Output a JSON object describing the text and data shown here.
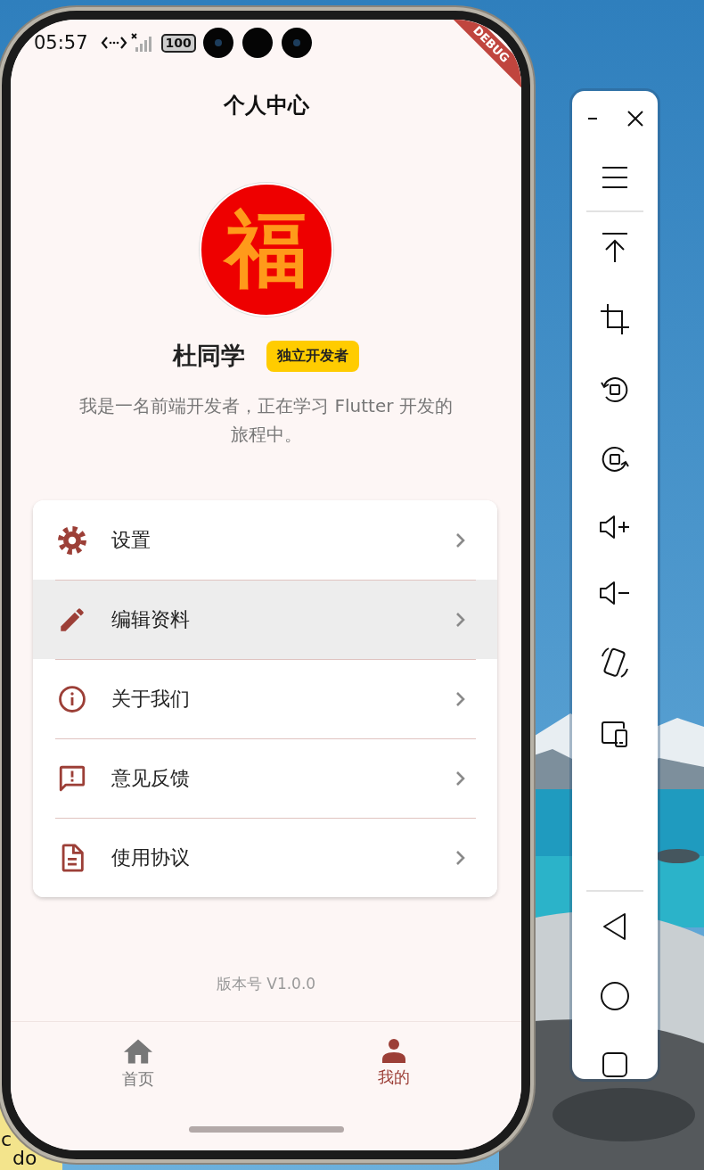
{
  "status_bar": {
    "time": "05:57",
    "battery": "100"
  },
  "debug_banner": "DEBUG",
  "header": {
    "title": "个人中心"
  },
  "profile": {
    "avatar_glyph": "福",
    "name": "杜同学",
    "badge": "独立开发者",
    "bio": "我是一名前端开发者，正在学习 Flutter 开发的旅程中。"
  },
  "menu": [
    {
      "label": "设置",
      "highlighted": false
    },
    {
      "label": "编辑资料",
      "highlighted": true
    },
    {
      "label": "关于我们",
      "highlighted": false
    },
    {
      "label": "意见反馈",
      "highlighted": false
    },
    {
      "label": "使用协议",
      "highlighted": false
    }
  ],
  "version": "版本号 V1.0.0",
  "bottom_nav": [
    {
      "label": "首页",
      "selected": false
    },
    {
      "label": "我的",
      "selected": true
    }
  ],
  "desktop_note": [
    "c",
    "do"
  ]
}
